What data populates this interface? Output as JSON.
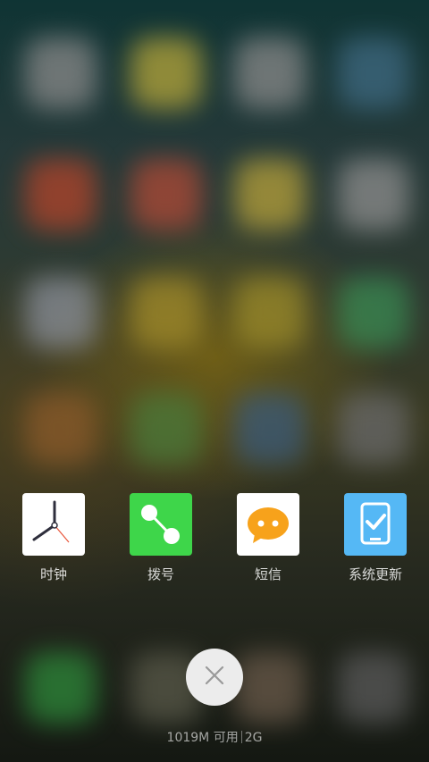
{
  "recent_apps": [
    {
      "label": "时钟",
      "icon": "clock-icon",
      "color": "#ffffff"
    },
    {
      "label": "拨号",
      "icon": "phone-dialer-icon",
      "color": "#3ed64a"
    },
    {
      "label": "短信",
      "icon": "messages-icon",
      "color": "#ffffff"
    },
    {
      "label": "系统更新",
      "icon": "system-update-icon",
      "color": "#55b8f5"
    }
  ],
  "clear_button": {
    "icon": "close-icon"
  },
  "memory": {
    "available": "1019M 可用",
    "total": "2G"
  }
}
